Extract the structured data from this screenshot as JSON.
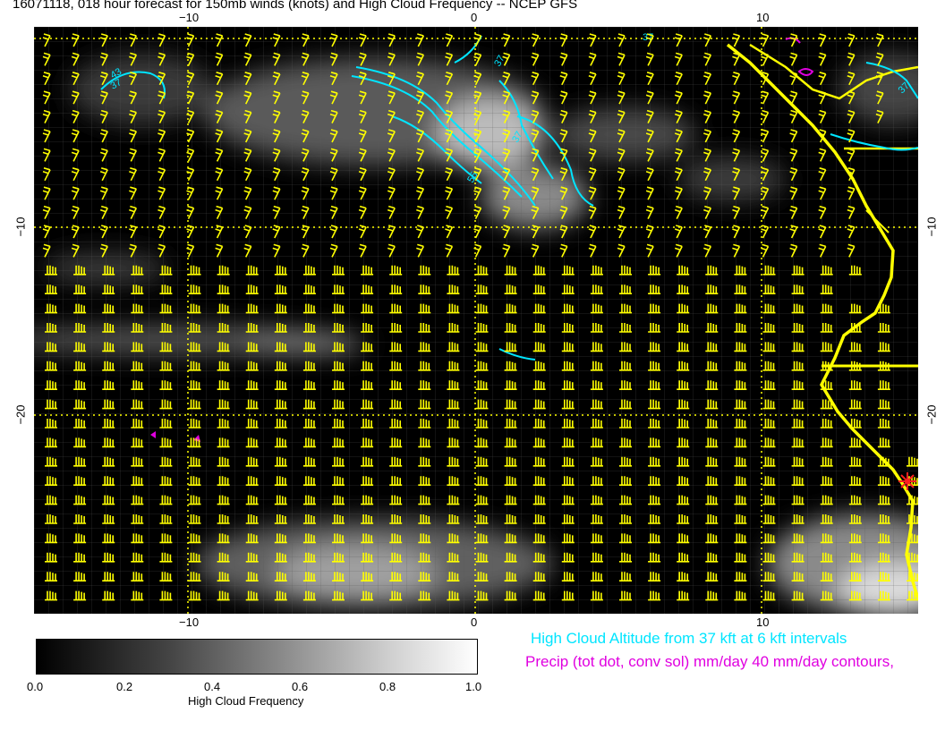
{
  "title": "16071118, 018 hour forecast for 150mb winds (knots) and High Cloud Frequency -- NCEP GFS",
  "axes": {
    "top_ticks": [
      "−10",
      "0",
      "10"
    ],
    "bottom_ticks": [
      "−10",
      "0",
      "10"
    ],
    "left_ticks": [
      "−10",
      "−20"
    ],
    "right_ticks": [
      "−10",
      "−20"
    ]
  },
  "map": {
    "background_color": "#000000",
    "barb_color": "#ffff00",
    "coast_color": "#ffff00",
    "contour_color": "#00e5ff",
    "precip_color": "#e000e0",
    "marker_color": "#ff2020",
    "contour_labels": [
      "43",
      "37",
      "37",
      "37",
      "37",
      "55",
      "37"
    ]
  },
  "colorbar": {
    "labels": [
      "0.0",
      "0.2",
      "0.4",
      "0.6",
      "0.8",
      "1.0"
    ],
    "title": "High Cloud Frequency"
  },
  "legend": {
    "line1": "High Cloud Altitude from 37 kft at 6 kft intervals",
    "line2": "Precip (tot dot, conv sol) mm/day 40 mm/day contours,"
  }
}
